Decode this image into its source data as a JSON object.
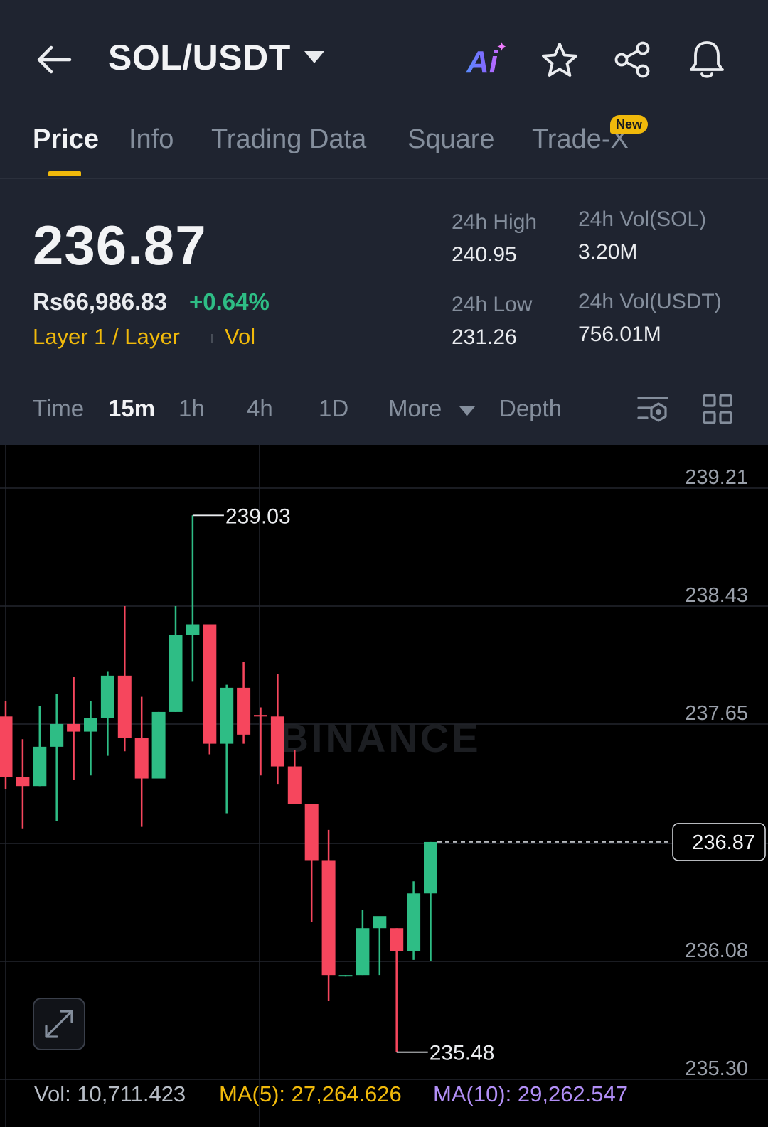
{
  "header": {
    "pair": "SOL/USDT",
    "ai_label": "Ai",
    "icons": [
      "back-arrow-icon",
      "caret-down-icon",
      "ai-icon",
      "star-icon",
      "share-icon",
      "bell-icon"
    ]
  },
  "tabs": {
    "items": [
      "Price",
      "Info",
      "Trading Data",
      "Square",
      "Trade-X"
    ],
    "active": "Price",
    "new_badge": "New"
  },
  "ticker": {
    "last_price": "236.87",
    "fiat_price": "Rs66,986.83",
    "change_pct": "+0.64%",
    "tag_sector": "Layer 1 / Layer",
    "tag_vol": "Vol",
    "high_label": "24h High",
    "high_value": "240.95",
    "low_label": "24h Low",
    "low_value": "231.26",
    "vol_sol_label": "24h Vol(SOL)",
    "vol_sol_value": "3.20M",
    "vol_usdt_label": "24h Vol(USDT)",
    "vol_usdt_value": "756.01M"
  },
  "intervals": {
    "time_label": "Time",
    "items": [
      "15m",
      "1h",
      "4h",
      "1D"
    ],
    "active": "15m",
    "more_label": "More",
    "depth_label": "Depth"
  },
  "colors": {
    "up": "#2ebd85",
    "down": "#f6465d",
    "accent": "#f0b90b",
    "ma5": "#f0b90b",
    "ma10": "#b18ef5",
    "background": "#1f2430",
    "chart_bg": "#000000"
  },
  "chart_data": {
    "type": "candlestick",
    "interval": "15m",
    "y_ticks": [
      "239.21",
      "238.43",
      "237.65",
      "236.86",
      "236.08",
      "235.30"
    ],
    "ylim": [
      235.3,
      239.21
    ],
    "current_price": "236.87",
    "high_marker": "239.03",
    "low_marker": "235.48",
    "watermark": "BINANCE",
    "candles": [
      {
        "o": 237.7,
        "h": 237.8,
        "l": 237.22,
        "c": 237.3
      },
      {
        "o": 237.3,
        "h": 237.55,
        "l": 236.96,
        "c": 237.24
      },
      {
        "o": 237.24,
        "h": 237.77,
        "l": 237.24,
        "c": 237.5
      },
      {
        "o": 237.5,
        "h": 237.85,
        "l": 237.01,
        "c": 237.65
      },
      {
        "o": 237.65,
        "h": 237.96,
        "l": 237.28,
        "c": 237.6
      },
      {
        "o": 237.6,
        "h": 237.8,
        "l": 237.31,
        "c": 237.69
      },
      {
        "o": 237.69,
        "h": 238.0,
        "l": 237.44,
        "c": 237.97
      },
      {
        "o": 237.97,
        "h": 238.43,
        "l": 237.47,
        "c": 237.56
      },
      {
        "o": 237.56,
        "h": 237.83,
        "l": 236.97,
        "c": 237.29
      },
      {
        "o": 237.29,
        "h": 237.73,
        "l": 237.29,
        "c": 237.73
      },
      {
        "o": 237.73,
        "h": 238.43,
        "l": 237.73,
        "c": 238.24
      },
      {
        "o": 238.24,
        "h": 239.03,
        "l": 237.93,
        "c": 238.31
      },
      {
        "o": 238.31,
        "h": 238.31,
        "l": 237.45,
        "c": 237.52
      },
      {
        "o": 237.52,
        "h": 237.91,
        "l": 237.06,
        "c": 237.89
      },
      {
        "o": 237.89,
        "h": 238.06,
        "l": 237.52,
        "c": 237.58
      },
      {
        "o": 237.71,
        "h": 237.76,
        "l": 237.31,
        "c": 237.7
      },
      {
        "o": 237.7,
        "h": 237.98,
        "l": 237.25,
        "c": 237.37
      },
      {
        "o": 237.37,
        "h": 237.48,
        "l": 237.12,
        "c": 237.12
      },
      {
        "o": 237.12,
        "h": 237.12,
        "l": 236.34,
        "c": 236.75
      },
      {
        "o": 236.75,
        "h": 236.95,
        "l": 235.82,
        "c": 235.99
      },
      {
        "o": 235.99,
        "h": 235.99,
        "l": 235.98,
        "c": 235.99
      },
      {
        "o": 235.99,
        "h": 236.42,
        "l": 235.99,
        "c": 236.3
      },
      {
        "o": 236.3,
        "h": 236.35,
        "l": 235.99,
        "c": 236.38
      },
      {
        "o": 236.3,
        "h": 236.3,
        "l": 235.48,
        "c": 236.15
      },
      {
        "o": 236.15,
        "h": 236.61,
        "l": 236.09,
        "c": 236.53
      },
      {
        "o": 236.53,
        "h": 236.87,
        "l": 236.08,
        "c": 236.87
      }
    ],
    "footer": {
      "vol": "Vol: 10,711.423",
      "ma5": "MA(5): 27,264.626",
      "ma10": "MA(10): 29,262.547"
    }
  }
}
